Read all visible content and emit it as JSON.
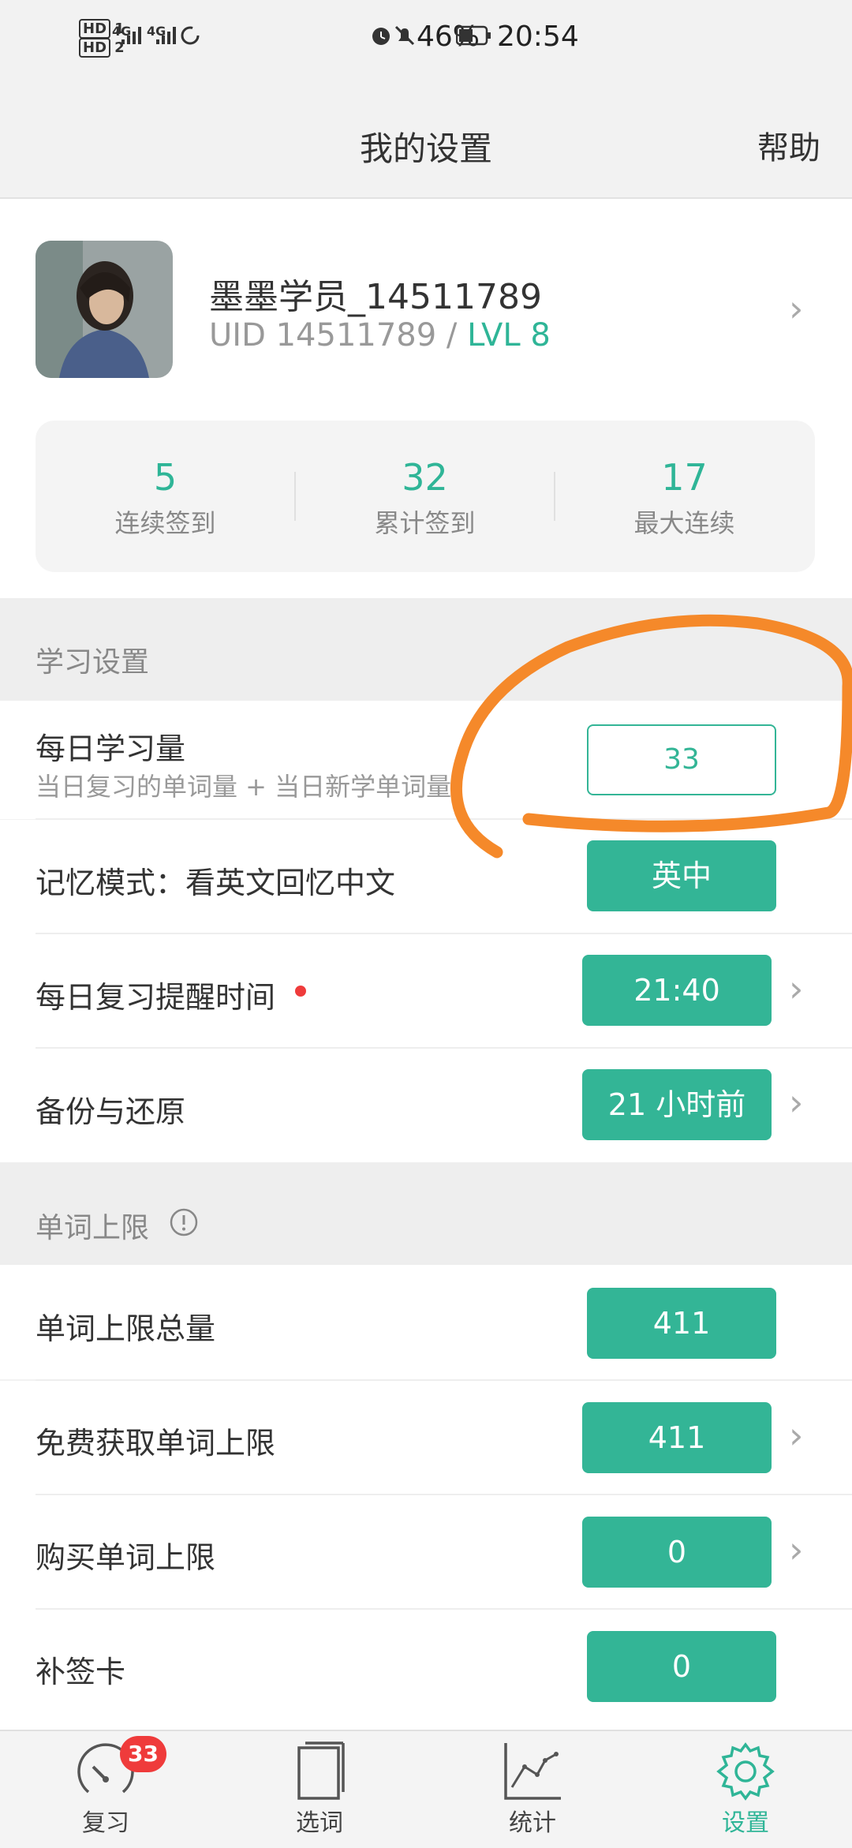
{
  "status_bar": {
    "hd1": "HD",
    "sim1": "1",
    "hd2": "HD",
    "sim2": "2",
    "net1": "4G",
    "net2": "4G",
    "battery_pct": "46%",
    "time": "20:54"
  },
  "header": {
    "title": "我的设置",
    "help": "帮助"
  },
  "profile": {
    "username": "墨墨学员_14511789",
    "uid_text": "UID 14511789 / ",
    "level": "LVL 8"
  },
  "stats": [
    {
      "value": "5",
      "label": "连续签到"
    },
    {
      "value": "32",
      "label": "累计签到"
    },
    {
      "value": "17",
      "label": "最大连续"
    }
  ],
  "study_section": {
    "title": "学习设置",
    "daily_amount": {
      "label": "每日学习量",
      "sub": "当日复习的单词量 + 当日新学单词量",
      "value": "33"
    },
    "memory_mode": {
      "label": "记忆模式：看英文回忆中文",
      "value": "英中"
    },
    "reminder": {
      "label": "每日复习提醒时间",
      "value": "21:40"
    },
    "backup": {
      "label": "备份与还原",
      "value": "21 小时前"
    }
  },
  "limit_section": {
    "title": "单词上限",
    "total": {
      "label": "单词上限总量",
      "value": "411"
    },
    "free": {
      "label": "免费获取单词上限",
      "value": "411"
    },
    "buy": {
      "label": "购买单词上限",
      "value": "0"
    },
    "card": {
      "label": "补签卡",
      "value": "0"
    }
  },
  "nav": [
    {
      "label": "复习",
      "badge": "33"
    },
    {
      "label": "选词"
    },
    {
      "label": "统计"
    },
    {
      "label": "设置"
    }
  ],
  "colors": {
    "accent": "#33b596",
    "annotation": "#f5892a",
    "badge": "#ef3b3b"
  }
}
